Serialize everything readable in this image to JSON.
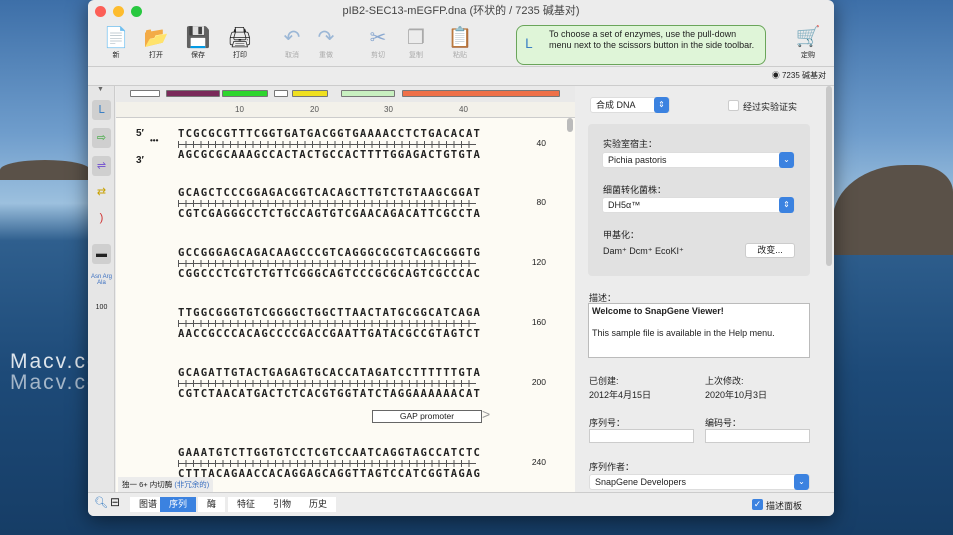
{
  "window": {
    "title": "pIB2-SEC13-mEGFP.dna  (环状的 / 7235 碱基对)"
  },
  "watermark": [
    "Macv.com",
    "Macv.com"
  ],
  "toolbar": {
    "new": "新",
    "open": "打开",
    "save": "保存",
    "print": "打印",
    "undo": "取消",
    "redo": "重做",
    "cut": "剪切",
    "copy": "复制",
    "paste": "粘贴",
    "buy": "定购",
    "tip": "To choose a set of enzymes, use the pull-down menu next to the scissors button in the side toolbar."
  },
  "status": {
    "length": "7235 碱基对"
  },
  "ruler": [
    "10",
    "20",
    "30",
    "40"
  ],
  "sequence": {
    "five": "5′",
    "three": "3′",
    "dots": "•••",
    "rows": [
      {
        "top": "TCGCGCGTTTCGGTGATGACGGTGAAAACCTCTGACACAT",
        "bottom": "AGCGCGCAAAGCCACTACTGCCACTTTTGGAGACTGTGTA",
        "num": "40"
      },
      {
        "top": "GCAGCTCCCGGAGACGGTCACAGCTTGTCTGTAAGCGGAT",
        "bottom": "CGTCGAGGGCCTCTGCCAGTGTCGAACAGACATTCGCCTA",
        "num": "80"
      },
      {
        "top": "GCCGGGAGCAGACAAGCCCGTCAGGGCGCGTCAGCGGGTG",
        "bottom": "CGGCCCTCGTCTGTTCGGGCAGTCCCGCGCAGTCGCCCAC",
        "num": "120"
      },
      {
        "top": "TTGGCGGGTGTCGGGGCTGGCTTAACTATGCGGCATCAGA",
        "bottom": "AACCGCCCACAGCCCCGACCGAATTGATACGCCGTAGTCT",
        "num": "160"
      },
      {
        "top": "GCAGATTGTACTGAGAGTGCACCATAGATCCTTTTTTGTA",
        "bottom": "CGTCTAACATGACTCTCACGTGGTATCTAGGAAAAAACAT",
        "num": "200"
      },
      {
        "top": "GAAATGTCTTGGTGTCCTCGTCCAATCAGGTAGCCATCTC",
        "bottom": "CTTTACAGAACCACAGGAGCAGGTTAGTCCATCGGTAGAG",
        "num": "240"
      }
    ],
    "feature": "GAP promoter",
    "enzymes": "独一 6+ 内切酶",
    "enzymes_note": "(非冗余的)"
  },
  "sidebar": {
    "aa": "Asn Arg Ala",
    "scale": "100"
  },
  "panel": {
    "type": "合成 DNA",
    "verified": "经过实验证实",
    "host_label": "实验室宿主：",
    "host": "Pichia pastoris",
    "strain_label": "细菌转化菌株：",
    "strain": "DH5α™",
    "methyl_label": "甲基化：",
    "methyl": "Dam⁺  Dcm⁺  EcoKI⁺",
    "change": "改变...",
    "desc_label": "描述：",
    "desc_title": "Welcome to SnapGene Viewer!",
    "desc_body": "This sample file is available in the Help menu.",
    "created_label": "已创建:",
    "created": "2012年4月15日",
    "modified_label": "上次修改:",
    "modified": "2020年10月3日",
    "serial_label": "序列号：",
    "serial": "",
    "code_label": "编码号：",
    "code": "",
    "author_label": "序列作者：",
    "author": "SnapGene Developers",
    "desc_panel": "描述面板"
  },
  "tabs": [
    "图谱",
    "序列",
    "酶",
    "特征",
    "引物",
    "历史"
  ]
}
